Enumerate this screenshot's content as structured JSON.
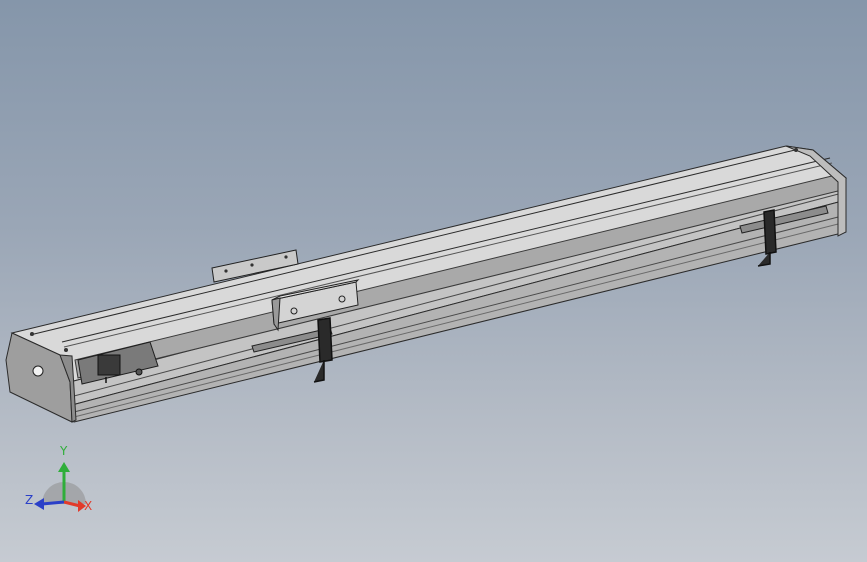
{
  "view": {
    "background_top": "#8596aa",
    "background_bottom": "#c6cbd2"
  },
  "triad": {
    "x": {
      "label": "X",
      "color": "#e23a2a"
    },
    "y": {
      "label": "Y",
      "color": "#2fae3a"
    },
    "z": {
      "label": "Z",
      "color": "#2a3fc8"
    }
  }
}
